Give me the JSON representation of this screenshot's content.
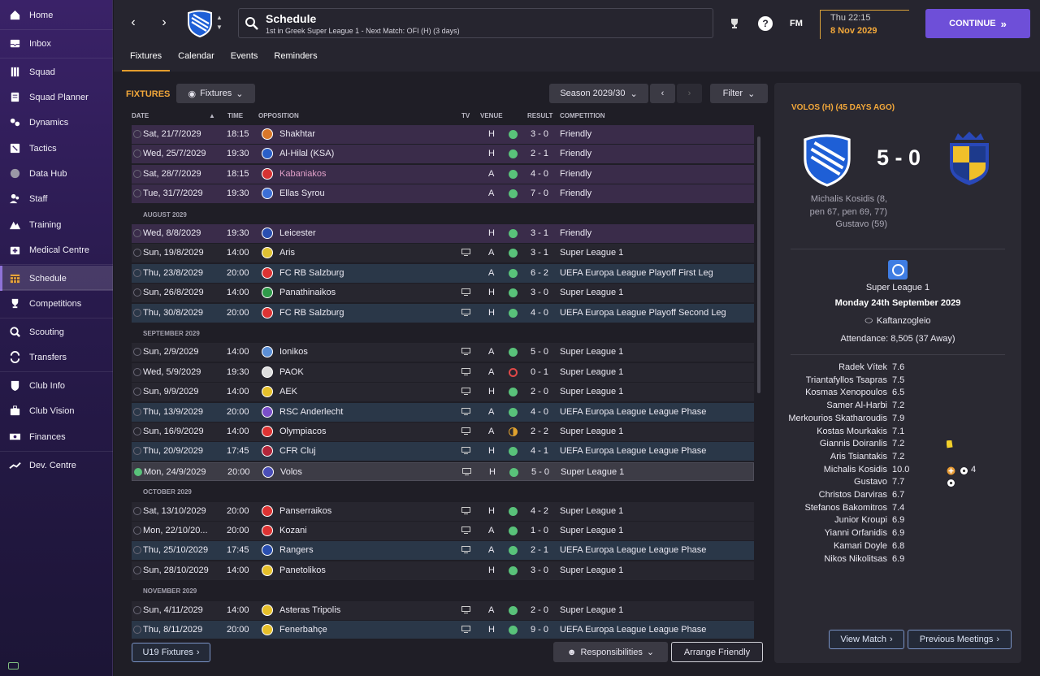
{
  "sidebar": {
    "items": [
      {
        "label": "Home",
        "icon": "home-icon"
      },
      {
        "label": "Inbox",
        "icon": "inbox-icon"
      },
      {
        "label": "Squad",
        "icon": "squad-icon"
      },
      {
        "label": "Squad Planner",
        "icon": "clipboard-icon"
      },
      {
        "label": "Dynamics",
        "icon": "dynamics-icon"
      },
      {
        "label": "Tactics",
        "icon": "tactics-icon"
      },
      {
        "label": "Data Hub",
        "icon": "data-hub-icon"
      },
      {
        "label": "Staff",
        "icon": "staff-icon"
      },
      {
        "label": "Training",
        "icon": "training-icon"
      },
      {
        "label": "Medical Centre",
        "icon": "medical-icon"
      },
      {
        "label": "Schedule",
        "icon": "calendar-icon"
      },
      {
        "label": "Competitions",
        "icon": "trophy-icon"
      },
      {
        "label": "Scouting",
        "icon": "scouting-icon"
      },
      {
        "label": "Transfers",
        "icon": "transfers-icon"
      },
      {
        "label": "Club Info",
        "icon": "shield-icon"
      },
      {
        "label": "Club Vision",
        "icon": "briefcase-icon"
      },
      {
        "label": "Finances",
        "icon": "money-icon"
      },
      {
        "label": "Dev. Centre",
        "icon": "dev-centre-icon"
      }
    ]
  },
  "header": {
    "title": "Schedule",
    "subtitle": "1st in Greek Super League 1 - Next Match: OFI (H) (3 days)",
    "fm_label": "FM",
    "date_time": "Thu 22:15",
    "date_day": "8 Nov 2029",
    "continue_label": "CONTINUE"
  },
  "tabs": [
    "Fixtures",
    "Calendar",
    "Events",
    "Reminders"
  ],
  "fixtures": {
    "section_label": "FIXTURES",
    "view_dropdown": "Fixtures",
    "season": "Season 2029/30",
    "filter": "Filter",
    "columns": [
      "DATE",
      "TIME",
      "OPPOSITION",
      "TV",
      "VENUE",
      "RESULT",
      "COMPETITION"
    ],
    "rows": [
      {
        "type": "match",
        "style": "friendly",
        "date": "Sat, 21/7/2029",
        "time": "18:15",
        "opp": "Shakhtar",
        "crest": "#d9772a",
        "tv": false,
        "venue": "H",
        "res": "W",
        "result": "3 - 0",
        "comp": "Friendly"
      },
      {
        "type": "match",
        "style": "friendly",
        "date": "Wed, 25/7/2029",
        "time": "19:30",
        "opp": "Al-Hilal (KSA)",
        "crest": "#2a5fc9",
        "tv": false,
        "venue": "H",
        "res": "W",
        "result": "2 - 1",
        "comp": "Friendly"
      },
      {
        "type": "match",
        "style": "friendly",
        "date": "Sat, 28/7/2029",
        "time": "18:15",
        "opp": "Kabaniakos",
        "crest": "#d63333",
        "tv": false,
        "venue": "A",
        "res": "W",
        "result": "4 - 0",
        "comp": "Friendly",
        "opp_dim": true
      },
      {
        "type": "match",
        "style": "friendly",
        "date": "Tue, 31/7/2029",
        "time": "19:30",
        "opp": "Ellas Syrou",
        "crest": "#3c6fd6",
        "tv": false,
        "venue": "A",
        "res": "W",
        "result": "7 - 0",
        "comp": "Friendly"
      },
      {
        "type": "month",
        "label": "AUGUST 2029"
      },
      {
        "type": "match",
        "style": "friendly",
        "date": "Wed, 8/8/2029",
        "time": "19:30",
        "opp": "Leicester",
        "crest": "#2a4fb0",
        "tv": false,
        "venue": "H",
        "res": "W",
        "result": "3 - 1",
        "comp": "Friendly"
      },
      {
        "type": "match",
        "style": "dark",
        "date": "Sun, 19/8/2029",
        "time": "14:00",
        "opp": "Aris",
        "crest": "#e0c132",
        "tv": true,
        "venue": "A",
        "res": "W",
        "result": "3 - 1",
        "comp": "Super League 1"
      },
      {
        "type": "match",
        "style": "europe",
        "date": "Thu, 23/8/2029",
        "time": "20:00",
        "opp": "FC RB Salzburg",
        "crest": "#d33",
        "tv": false,
        "venue": "A",
        "res": "W",
        "result": "6 - 2",
        "comp": "UEFA Europa League Playoff First Leg"
      },
      {
        "type": "match",
        "style": "dark",
        "date": "Sun, 26/8/2029",
        "time": "14:00",
        "opp": "Panathinaikos",
        "crest": "#2f9b4a",
        "tv": true,
        "venue": "H",
        "res": "W",
        "result": "3 - 0",
        "comp": "Super League 1"
      },
      {
        "type": "match",
        "style": "europe",
        "date": "Thu, 30/8/2029",
        "time": "20:00",
        "opp": "FC RB Salzburg",
        "crest": "#d33",
        "tv": true,
        "venue": "H",
        "res": "W",
        "result": "4 - 0",
        "comp": "UEFA Europa League Playoff Second Leg"
      },
      {
        "type": "month",
        "label": "SEPTEMBER 2029"
      },
      {
        "type": "match",
        "style": "dark",
        "date": "Sun, 2/9/2029",
        "time": "14:00",
        "opp": "Ionikos",
        "crest": "#5b8fd6",
        "tv": true,
        "venue": "A",
        "res": "W",
        "result": "5 - 0",
        "comp": "Super League 1"
      },
      {
        "type": "match",
        "style": "dark",
        "date": "Wed, 5/9/2029",
        "time": "19:30",
        "opp": "PAOK",
        "crest": "#dddddd",
        "tv": true,
        "venue": "A",
        "res": "L",
        "result": "0 - 1",
        "comp": "Super League 1"
      },
      {
        "type": "match",
        "style": "dark",
        "date": "Sun, 9/9/2029",
        "time": "14:00",
        "opp": "AEK",
        "crest": "#e6c02b",
        "tv": true,
        "venue": "H",
        "res": "W",
        "result": "2 - 0",
        "comp": "Super League 1"
      },
      {
        "type": "match",
        "style": "europe",
        "date": "Thu, 13/9/2029",
        "time": "20:00",
        "opp": "RSC Anderlecht",
        "crest": "#7b4fc9",
        "tv": true,
        "venue": "A",
        "res": "W",
        "result": "4 - 0",
        "comp": "UEFA Europa League League Phase"
      },
      {
        "type": "match",
        "style": "dark",
        "date": "Sun, 16/9/2029",
        "time": "14:00",
        "opp": "Olympiacos",
        "crest": "#d33",
        "tv": true,
        "venue": "A",
        "res": "D",
        "result": "2 - 2",
        "comp": "Super League 1"
      },
      {
        "type": "match",
        "style": "europe",
        "date": "Thu, 20/9/2029",
        "time": "17:45",
        "opp": "CFR Cluj",
        "crest": "#b3263a",
        "tv": true,
        "venue": "H",
        "res": "W",
        "result": "4 - 1",
        "comp": "UEFA Europa League League Phase"
      },
      {
        "type": "match",
        "style": "sel",
        "date": "Mon, 24/9/2029",
        "time": "20:00",
        "opp": "Volos",
        "crest": "#4b4fb8",
        "tv": true,
        "venue": "H",
        "res": "W",
        "result": "5 - 0",
        "comp": "Super League 1",
        "checked": true
      },
      {
        "type": "month",
        "label": "OCTOBER 2029"
      },
      {
        "type": "match",
        "style": "dark",
        "date": "Sat, 13/10/2029",
        "time": "20:00",
        "opp": "Panserraikos",
        "crest": "#d33",
        "tv": true,
        "venue": "H",
        "res": "W",
        "result": "4 - 2",
        "comp": "Super League 1"
      },
      {
        "type": "match",
        "style": "dark",
        "date": "Mon, 22/10/20...",
        "time": "20:00",
        "opp": "Kozani",
        "crest": "#d33",
        "tv": true,
        "venue": "A",
        "res": "W",
        "result": "1 - 0",
        "comp": "Super League 1"
      },
      {
        "type": "match",
        "style": "europe",
        "date": "Thu, 25/10/2029",
        "time": "17:45",
        "opp": "Rangers",
        "crest": "#2a4fb0",
        "tv": true,
        "venue": "A",
        "res": "W",
        "result": "2 - 1",
        "comp": "UEFA Europa League League Phase"
      },
      {
        "type": "match",
        "style": "dark",
        "date": "Sun, 28/10/2029",
        "time": "14:00",
        "opp": "Panetolikos",
        "crest": "#e6c02b",
        "tv": false,
        "venue": "H",
        "res": "W",
        "result": "3 - 0",
        "comp": "Super League 1"
      },
      {
        "type": "month",
        "label": "NOVEMBER 2029"
      },
      {
        "type": "match",
        "style": "dark",
        "date": "Sun, 4/11/2029",
        "time": "14:00",
        "opp": "Asteras Tripolis",
        "crest": "#e6c02b",
        "tv": true,
        "venue": "A",
        "res": "W",
        "result": "2 - 0",
        "comp": "Super League 1"
      },
      {
        "type": "match",
        "style": "europe",
        "date": "Thu, 8/11/2029",
        "time": "20:00",
        "opp": "Fenerbahçe",
        "crest": "#e6c02b",
        "tv": true,
        "venue": "H",
        "res": "W",
        "result": "9 - 0",
        "comp": "UEFA Europa League League Phase"
      }
    ],
    "u19_button": "U19 Fixtures",
    "responsibilities": "Responsibilities",
    "arrange_friendly": "Arrange Friendly"
  },
  "match_panel": {
    "title": "VOLOS (H) (45 DAYS AGO)",
    "score": "5 - 0",
    "scorers_lines": [
      "Michalis Kosidis (8,",
      "pen 67, pen 69, 77)",
      "Gustavo (59)"
    ],
    "competition": "Super League 1",
    "date": "Monday 24th September 2029",
    "stadium": "Kaftanzogleio",
    "attendance": "Attendance: 8,505 (37 Away)",
    "ratings": [
      {
        "name": "Radek Vítek",
        "rating": "7.6"
      },
      {
        "name": "Triantafyllos Tsapras",
        "rating": "7.5"
      },
      {
        "name": "Kosmas Xenopoulos",
        "rating": "6.5"
      },
      {
        "name": "Samer Al-Harbi",
        "rating": "7.2"
      },
      {
        "name": "Merkourios Skatharoudis",
        "rating": "7.9"
      },
      {
        "name": "Kostas Mourkakis",
        "rating": "7.1"
      },
      {
        "name": "Giannis Doiranlis",
        "rating": "7.2",
        "icons": "yellow"
      },
      {
        "name": "Aris Tsiantakis",
        "rating": "7.2"
      },
      {
        "name": "Michalis Kosidis",
        "rating": "10.0",
        "icons": "motm-goals",
        "goals": "4"
      },
      {
        "name": "Gustavo",
        "rating": "7.7",
        "icons": "goal"
      },
      {
        "name": "Christos Darviras",
        "rating": "6.7"
      },
      {
        "name": "Stefanos Bakomitros",
        "rating": "7.4"
      },
      {
        "name": "Junior Kroupi",
        "rating": "6.9"
      },
      {
        "name": "Yianni Orfanidis",
        "rating": "6.9"
      },
      {
        "name": "Kamari Doyle",
        "rating": "6.8"
      },
      {
        "name": "Nikos Nikolitsas",
        "rating": "6.9"
      }
    ],
    "view_match": "View Match",
    "previous_meetings": "Previous Meetings"
  },
  "colors": {
    "accent": "#6e4fd8",
    "highlight": "#f3a83a",
    "win": "#59c27a",
    "loss": "#e04848",
    "draw": "#e0a22e"
  }
}
